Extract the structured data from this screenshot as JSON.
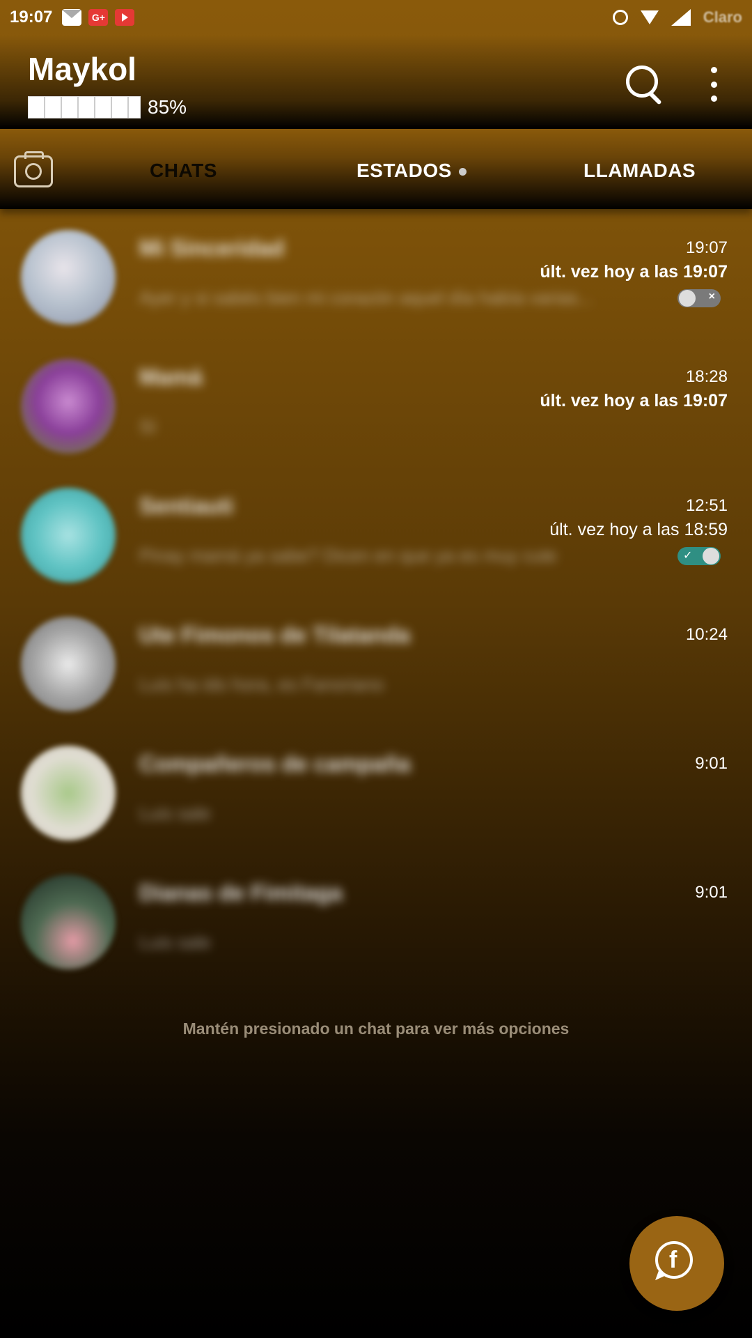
{
  "statusbar": {
    "time": "19:07",
    "carrier": "Claro",
    "gplus_label": "G+"
  },
  "header": {
    "title": "Maykol",
    "battery_label": "85%"
  },
  "tabs": [
    {
      "label": "CHATS"
    },
    {
      "label": "ESTADOS"
    },
    {
      "label": "LLAMADAS"
    }
  ],
  "chats": [
    {
      "name": "Mi Sinceridad",
      "preview": "Ayer y si sabés bien mi corazón aquel día había varias...",
      "time": "19:07",
      "last_seen_prefix": "últ. vez hoy a las ",
      "last_seen_time": "19:07",
      "toggle": "off",
      "avatar_color": "#c9cfd6"
    },
    {
      "name": "Mamá",
      "preview": "Sí",
      "time": "18:28",
      "last_seen_prefix": "últ. vez hoy a las ",
      "last_seen_time": "19:07",
      "toggle": "",
      "avatar_color": "#8a3f9a"
    },
    {
      "name": "Sentiauti",
      "preview": "Pinay mamá ya sabe? Dicen en que ya es muy cute",
      "time": "12:51",
      "last_seen_prefix": "últ. vez hoy a las ",
      "last_seen_time": "18:59",
      "toggle": "on",
      "avatar_color": "#5fc3c3"
    },
    {
      "name": "Ute Fimonos de Tilatanda",
      "preview": "Luis ha ido hora, es Fanoriano",
      "time": "10:24",
      "last_seen_prefix": "",
      "last_seen_time": "",
      "toggle": "",
      "avatar_color": "#b9b9b9"
    },
    {
      "name": "Compañeros de campaña",
      "preview": "Luis sale",
      "time": "9:01",
      "last_seen_prefix": "",
      "last_seen_time": "",
      "toggle": "",
      "avatar_color": "#e0ddd2"
    },
    {
      "name": "Dianas de Fimitaga",
      "preview": "Luis sale",
      "time": "9:01",
      "last_seen_prefix": "",
      "last_seen_time": "",
      "toggle": "",
      "avatar_color": "#4e6a52"
    }
  ],
  "hint": "Mantén presionado un chat para ver más opciones",
  "toggle_marks": {
    "off": "×",
    "on": "✓"
  },
  "fab": {
    "letter": "f"
  },
  "colors": {
    "accent": "#9a6514",
    "background_top": "#8a5a0b",
    "background_bottom": "#000000"
  }
}
